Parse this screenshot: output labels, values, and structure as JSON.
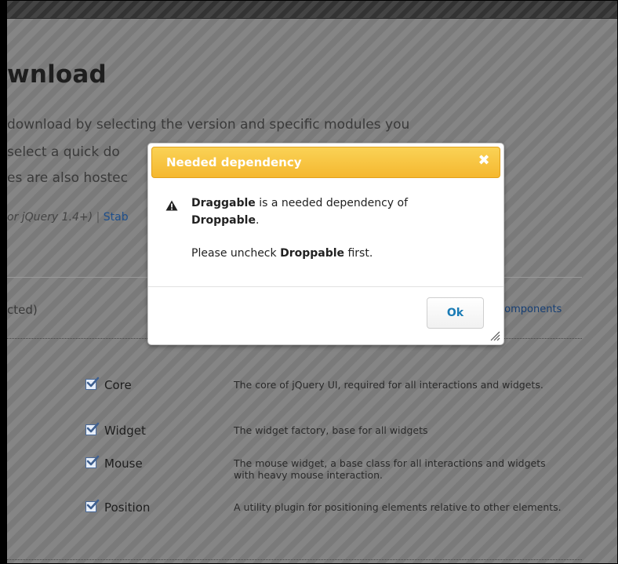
{
  "page": {
    "title": "wnload",
    "intro_lines": [
      "download by selecting the version and specific modules you",
      "select a quick do",
      "es are also hostec"
    ],
    "version": {
      "italic_text": "or jQuery 1.4+)",
      "separator": "|",
      "link_text": "Stab"
    },
    "selected_label": "cted)",
    "toggle_link": "components"
  },
  "modules": [
    {
      "name": "Core",
      "checked": true,
      "description": "The core of jQuery UI, required for all interactions and widgets."
    },
    {
      "name": "Widget",
      "checked": true,
      "description": "The widget factory, base for all widgets"
    },
    {
      "name": "Mouse",
      "checked": true,
      "description": "The mouse widget, a base class for all interactions and widgets with heavy mouse interaction."
    },
    {
      "name": "Position",
      "checked": true,
      "description": "A utility plugin for positioning elements relative to other elements."
    }
  ],
  "dialog": {
    "title": "Needed dependency",
    "close_glyph": "✖",
    "message": {
      "dependency": "Draggable",
      "line1_rest": " is a needed dependency of",
      "dependent": "Droppable",
      "line2_end": ".",
      "line3_prefix": "Please uncheck ",
      "line3_target": "Droppable",
      "line3_suffix": " first."
    },
    "ok_label": "Ok"
  },
  "colors": {
    "dialog_title_bg": "#f5b82f",
    "ok_text": "#1a7bb5",
    "link": "#1e4f8c"
  }
}
